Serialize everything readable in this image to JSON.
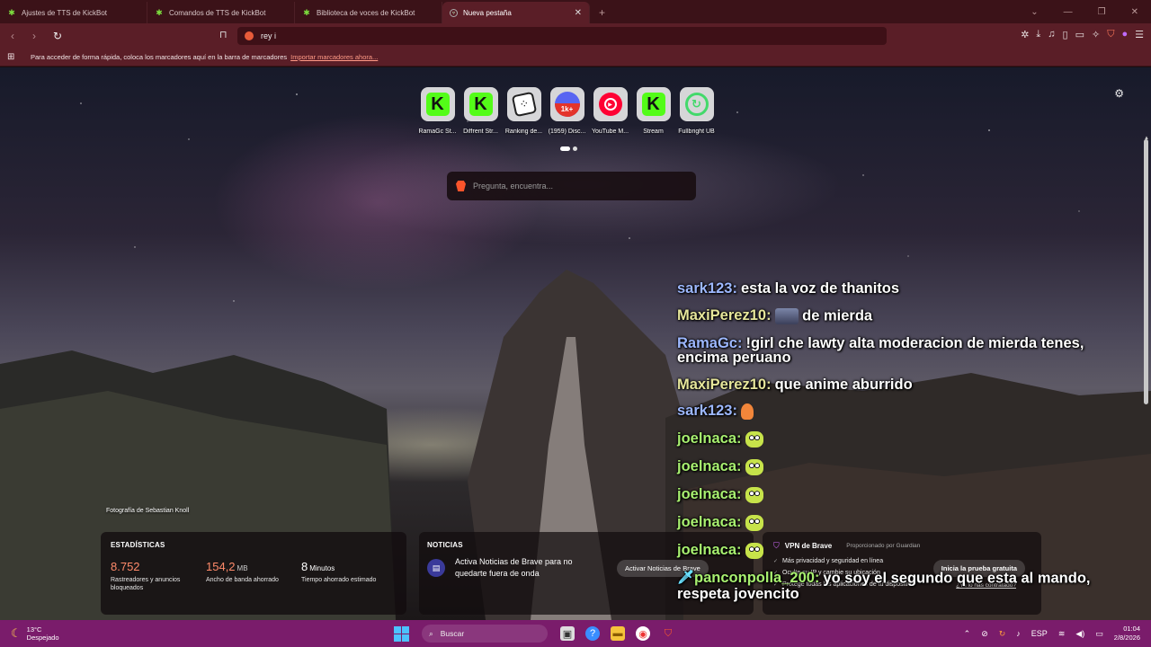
{
  "tabs": [
    {
      "label": "Ajustes de TTS de KickBot",
      "active": false
    },
    {
      "label": "Comandos de TTS de KickBot",
      "active": false
    },
    {
      "label": "Biblioteca de voces de KickBot",
      "active": false
    },
    {
      "label": "Nueva pestaña",
      "active": true
    }
  ],
  "toolbar": {
    "address_value": "rey i"
  },
  "bookmarks_bar": {
    "message": "Para acceder de forma rápida, coloca los marcadores aquí en la barra de marcadores",
    "import_link": "Importar marcadores ahora..."
  },
  "top_sites": [
    {
      "label": "RamaGc St...",
      "icon": "kick-icon"
    },
    {
      "label": "Diffrent Str...",
      "icon": "kick-icon"
    },
    {
      "label": "Ranking de...",
      "icon": "dice-icon"
    },
    {
      "label": "(1959) Disc...",
      "icon": "discord-icon",
      "badge": "1k+"
    },
    {
      "label": "YouTube M...",
      "icon": "youtube-music-icon"
    },
    {
      "label": "Stream",
      "icon": "kick-icon"
    },
    {
      "label": "Fullbright UB",
      "icon": "fullbright-icon"
    }
  ],
  "search": {
    "placeholder": "Pregunta, encuentra..."
  },
  "photo_credit": "Fotografía de Sebastian Knoll",
  "stats": {
    "title": "ESTADÍSTICAS",
    "items": [
      {
        "value": "8.752",
        "unit": "",
        "desc": "Rastreadores y anuncios bloqueados",
        "color": "#ff8a6a"
      },
      {
        "value": "154,2",
        "unit": "MB",
        "desc": "Ancho de banda ahorrado",
        "color": "#ff8a6a"
      },
      {
        "value": "8",
        "unit": "Minutos",
        "desc": "Tiempo ahorrado estimado",
        "color": "#ffffff"
      }
    ]
  },
  "news": {
    "title": "NOTICIAS",
    "text": "Activa Noticias de Brave para no quedarte fuera de onda",
    "button": "Activar Noticias de Brave"
  },
  "vpn": {
    "title": "VPN de Brave",
    "provider": "Proporcionado por Guardian",
    "features": [
      "Más privacidad y seguridad en línea",
      "Oculte su IP y cambie su ubicación",
      "Protege todas las aplicaciones de tu dispositivo"
    ],
    "button": "Inicia la prueba gratuita",
    "link": "¿Ya lo has contratado?"
  },
  "chat": [
    {
      "user": "sark123:",
      "color": "blue",
      "text": "esta la voz de thanitos",
      "emote": ""
    },
    {
      "user": "MaxiPerez10:",
      "color": "yellow",
      "text": "de mierda",
      "emote": "avatar"
    },
    {
      "user": "RamaGc:",
      "color": "blue",
      "text": "!girl che lawty alta moderacion de mierda tenes, encima peruano",
      "emote": ""
    },
    {
      "user": "MaxiPerez10:",
      "color": "yellow",
      "text": "que anime aburrido",
      "emote": ""
    },
    {
      "user": "sark123:",
      "color": "blue",
      "text": "",
      "emote": "hand"
    },
    {
      "user": "joelnaca:",
      "color": "green",
      "text": "",
      "emote": "pepe"
    },
    {
      "user": "joelnaca:",
      "color": "green",
      "text": "",
      "emote": "pepe"
    },
    {
      "user": "joelnaca:",
      "color": "green",
      "text": "",
      "emote": "pepe"
    },
    {
      "user": "joelnaca:",
      "color": "green",
      "text": "",
      "emote": "pepe"
    },
    {
      "user": "joelnaca:",
      "color": "green",
      "text": "",
      "emote": "pepe"
    },
    {
      "user": "panconpolla_200:",
      "color": "green",
      "text": "yo soy el segundo que esta al mando, respeta jovencito",
      "emote": "sword"
    }
  ],
  "taskbar": {
    "weather_temp": "13°C",
    "weather_desc": "Despejado",
    "search_label": "Buscar",
    "language": "ESP",
    "time": "01:04",
    "date": "2/8/2026"
  }
}
